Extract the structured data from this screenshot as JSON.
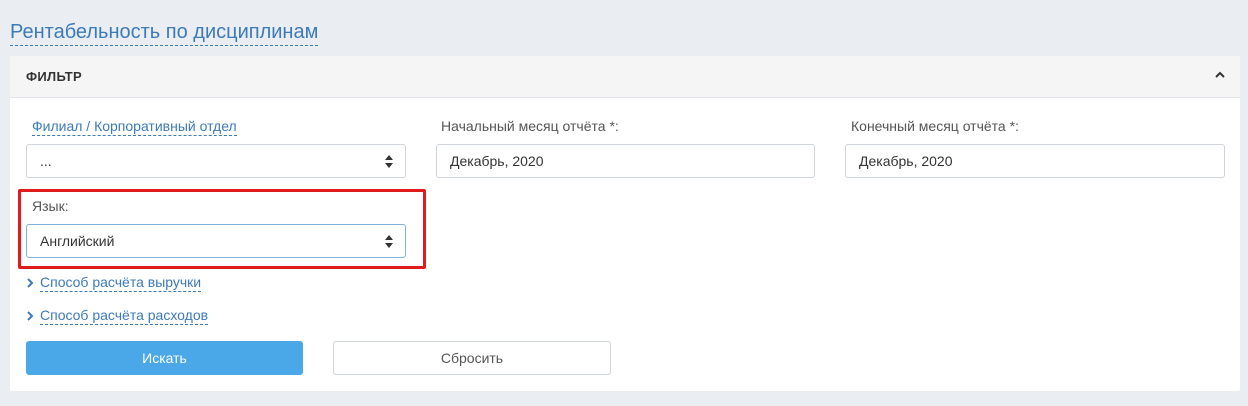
{
  "page": {
    "title": "Рентабельность по дисциплинам"
  },
  "filter": {
    "header": "ФИЛЬТР",
    "branch": {
      "label": "Филиал / Корпоративный отдел",
      "value": "..."
    },
    "start_month": {
      "label": "Начальный месяц отчёта *:",
      "value": "Декабрь, 2020"
    },
    "end_month": {
      "label": "Конечный месяц отчёта *:",
      "value": "Декабрь, 2020"
    },
    "language": {
      "label": "Язык:",
      "value": "Английский"
    },
    "revenue_method": {
      "label": "Способ расчёта выручки"
    },
    "expense_method": {
      "label": "Способ расчёта расходов"
    },
    "search_label": "Искать",
    "reset_label": "Сбросить"
  },
  "colors": {
    "accent": "#3c7ab8",
    "primary_button": "#4aa8e8",
    "highlight": "#e01b1b"
  },
  "icons": {
    "collapse": "chevron-up-icon",
    "select": "sort-arrows-icon",
    "expand": "chevron-right-icon"
  }
}
